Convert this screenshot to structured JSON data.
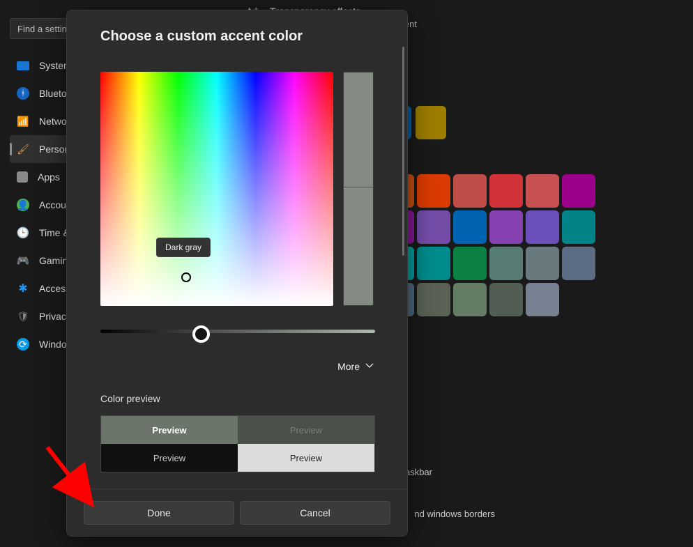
{
  "search": {
    "placeholder": "Find a setting"
  },
  "sidebar": {
    "items": [
      {
        "label": "System"
      },
      {
        "label": "Bluetooth"
      },
      {
        "label": "Network"
      },
      {
        "label": "Personalization"
      },
      {
        "label": "Apps"
      },
      {
        "label": "Accounts"
      },
      {
        "label": "Time & language"
      },
      {
        "label": "Gaming"
      },
      {
        "label": "Accessibility"
      },
      {
        "label": "Privacy"
      },
      {
        "label": "Windows Update"
      }
    ]
  },
  "right_panel": {
    "trans_label": "Transparency effects",
    "cent_label": "cent",
    "taskbar_line": "askbar",
    "borders_line": "nd windows borders",
    "swatch_top": [
      "#0063b1",
      "#9e7e00"
    ],
    "swatch_grid": [
      "#ca5010",
      "#da3b01",
      "#c14d48",
      "#d13438",
      "#c75150",
      "#9a0089",
      "#881798",
      "#744da9",
      "#0063b1",
      "#8640b0",
      "#6b4fba",
      "#038387",
      "#00a3a3",
      "#008c8c",
      "#0a8043",
      "#567c73",
      "#69797e",
      "#5c6c84",
      "#4f6a83",
      "#5a6255",
      "#647c64",
      "#525e54",
      "#778192"
    ]
  },
  "modal": {
    "title": "Choose a custom accent color",
    "tooltip": "Dark gray",
    "more_label": "More",
    "color_preview_label": "Color preview",
    "preview_labels": {
      "a": "Preview",
      "b": "Preview",
      "c": "Preview",
      "d": "Preview"
    },
    "done_label": "Done",
    "cancel_label": "Cancel",
    "selected_color": "#848b82"
  }
}
